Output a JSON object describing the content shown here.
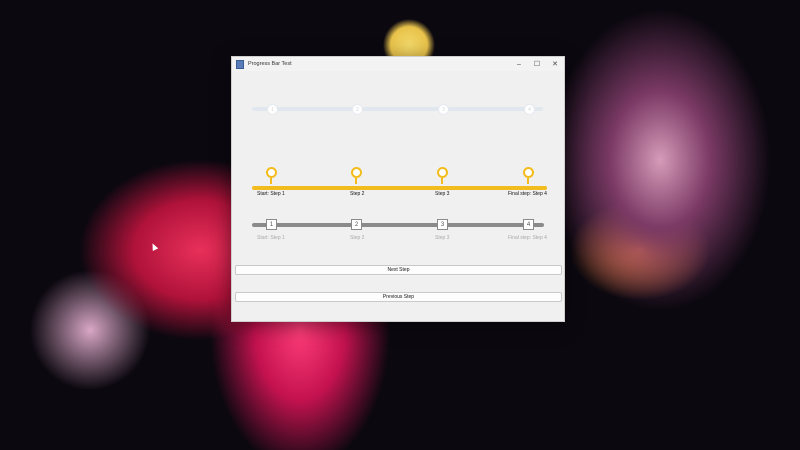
{
  "window": {
    "title": "Progress Bar Test",
    "minimize": "–",
    "maximize": "☐",
    "close": "✕"
  },
  "progress_bar_1": {
    "step_numbers": [
      "1",
      "2",
      "3",
      "4"
    ]
  },
  "progress_bar_2": {
    "labels": [
      "Start: Step 1",
      "Step 2",
      "Step 3",
      "Final step: Step 4"
    ]
  },
  "progress_bar_3": {
    "step_numbers": [
      "1",
      "2",
      "3",
      "4"
    ],
    "labels": [
      "Start: Step 1",
      "Step 2",
      "Step 3",
      "Final step: Step 4"
    ]
  },
  "buttons": {
    "next": "Next Step",
    "previous": "Previous Step"
  },
  "colors": {
    "gold": "#f3bc1d",
    "gray": "#8a8a8a",
    "faded": "#e1e7ee"
  }
}
